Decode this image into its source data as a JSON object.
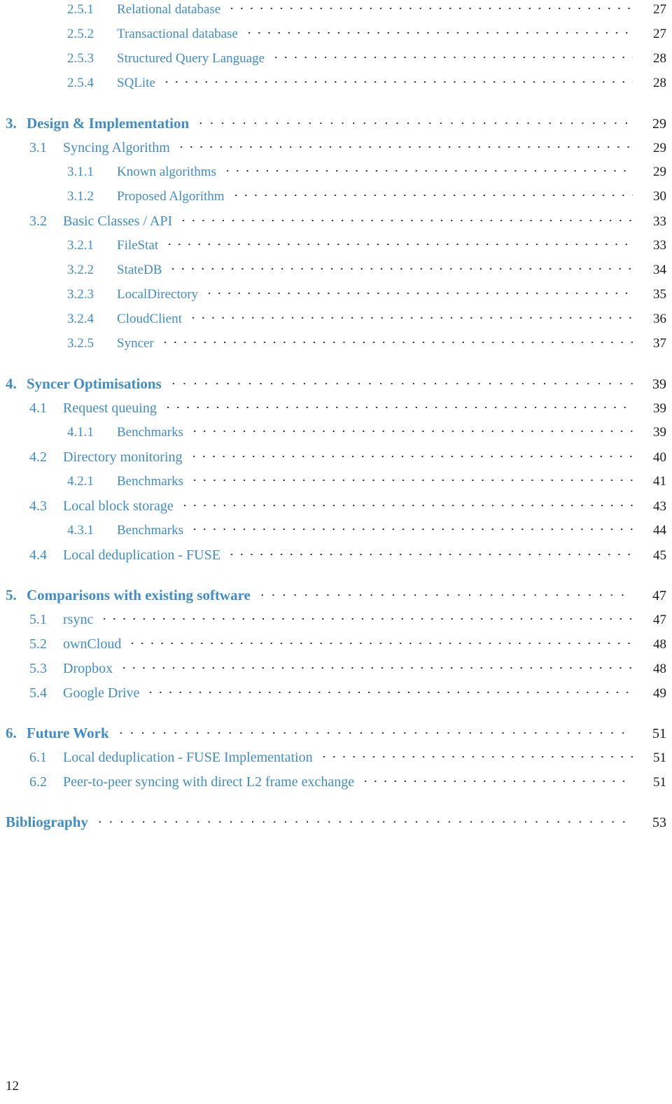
{
  "document": {
    "folio": "12",
    "accent_color": "#3f8ccb",
    "page_number_color": "#1a1a1a",
    "leader_color": "#2b2b2b"
  },
  "toc": {
    "entries": [
      {
        "level": 3,
        "number": "2.5.1",
        "label": "Relational database",
        "page": "27",
        "gap_before": false
      },
      {
        "level": 3,
        "number": "2.5.2",
        "label": "Transactional database",
        "page": "27",
        "gap_before": false
      },
      {
        "level": 3,
        "number": "2.5.3",
        "label": "Structured Query Language",
        "page": "28",
        "gap_before": false
      },
      {
        "level": 3,
        "number": "2.5.4",
        "label": "SQLite",
        "page": "28",
        "gap_before": false
      },
      {
        "level": 1,
        "number": "3.",
        "label": "Design & Implementation",
        "page": "29",
        "gap_before": true
      },
      {
        "level": 2,
        "number": "3.1",
        "label": "Syncing Algorithm",
        "page": "29",
        "gap_before": false
      },
      {
        "level": 3,
        "number": "3.1.1",
        "label": "Known algorithms",
        "page": "29",
        "gap_before": false
      },
      {
        "level": 3,
        "number": "3.1.2",
        "label": "Proposed Algorithm",
        "page": "30",
        "gap_before": false
      },
      {
        "level": 2,
        "number": "3.2",
        "label": "Basic Classes / API",
        "page": "33",
        "gap_before": false
      },
      {
        "level": 3,
        "number": "3.2.1",
        "label": "FileStat",
        "page": "33",
        "gap_before": false
      },
      {
        "level": 3,
        "number": "3.2.2",
        "label": "StateDB",
        "page": "34",
        "gap_before": false
      },
      {
        "level": 3,
        "number": "3.2.3",
        "label": "LocalDirectory",
        "page": "35",
        "gap_before": false
      },
      {
        "level": 3,
        "number": "3.2.4",
        "label": "CloudClient",
        "page": "36",
        "gap_before": false
      },
      {
        "level": 3,
        "number": "3.2.5",
        "label": "Syncer",
        "page": "37",
        "gap_before": false
      },
      {
        "level": 1,
        "number": "4.",
        "label": "Syncer Optimisations",
        "page": "39",
        "gap_before": true
      },
      {
        "level": 2,
        "number": "4.1",
        "label": "Request queuing",
        "page": "39",
        "gap_before": false
      },
      {
        "level": 3,
        "number": "4.1.1",
        "label": "Benchmarks",
        "page": "39",
        "gap_before": false
      },
      {
        "level": 2,
        "number": "4.2",
        "label": "Directory monitoring",
        "page": "40",
        "gap_before": false
      },
      {
        "level": 3,
        "number": "4.2.1",
        "label": "Benchmarks",
        "page": "41",
        "gap_before": false
      },
      {
        "level": 2,
        "number": "4.3",
        "label": "Local block storage",
        "page": "43",
        "gap_before": false
      },
      {
        "level": 3,
        "number": "4.3.1",
        "label": "Benchmarks",
        "page": "44",
        "gap_before": false
      },
      {
        "level": 2,
        "number": "4.4",
        "label": "Local deduplication - FUSE",
        "page": "45",
        "gap_before": false
      },
      {
        "level": 1,
        "number": "5.",
        "label": "Comparisons with existing software",
        "page": "47",
        "gap_before": true
      },
      {
        "level": 2,
        "number": "5.1",
        "label": "rsync",
        "page": "47",
        "gap_before": false
      },
      {
        "level": 2,
        "number": "5.2",
        "label": "ownCloud",
        "page": "48",
        "gap_before": false
      },
      {
        "level": 2,
        "number": "5.3",
        "label": "Dropbox",
        "page": "48",
        "gap_before": false
      },
      {
        "level": 2,
        "number": "5.4",
        "label": "Google Drive",
        "page": "49",
        "gap_before": false
      },
      {
        "level": 1,
        "number": "6.",
        "label": "Future Work",
        "page": "51",
        "gap_before": true
      },
      {
        "level": 2,
        "number": "6.1",
        "label": "Local deduplication - FUSE Implementation",
        "page": "51",
        "gap_before": false
      },
      {
        "level": 2,
        "number": "6.2",
        "label": "Peer-to-peer syncing with direct L2 frame exchange",
        "page": "51",
        "gap_before": false
      },
      {
        "level": 1,
        "number": "",
        "label": "Bibliography",
        "page": "53",
        "gap_before": true
      }
    ]
  }
}
